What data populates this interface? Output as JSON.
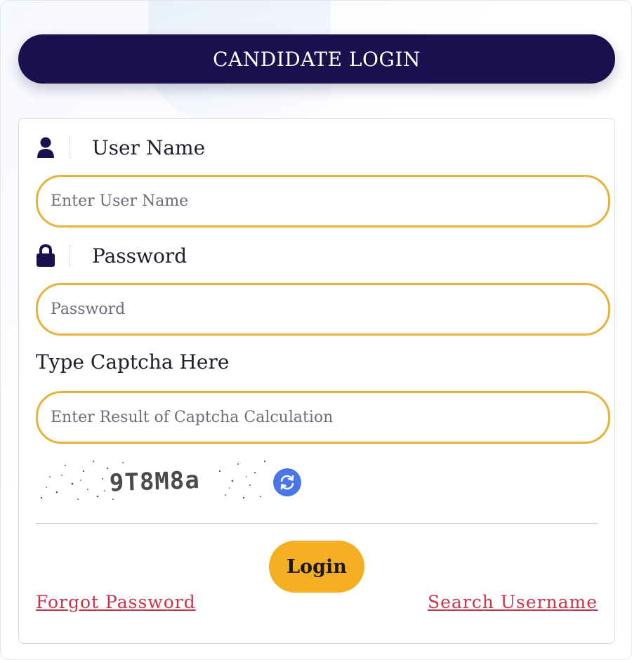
{
  "header": {
    "title": "CANDIDATE LOGIN"
  },
  "form": {
    "username": {
      "label": "User Name",
      "placeholder": "Enter User Name",
      "value": "",
      "icon": "user-icon"
    },
    "password": {
      "label": "Password",
      "placeholder": "Password",
      "value": "",
      "icon": "lock-icon"
    },
    "captcha": {
      "label": "Type Captcha Here",
      "placeholder": "Enter Result of Captcha Calculation",
      "value": "",
      "image_text": "9T8M8a",
      "refresh_icon": "refresh-icon"
    },
    "login_label": "Login",
    "forgot_password_label": "Forgot Password",
    "search_username_label": "Search Username"
  },
  "colors": {
    "header_bg": "#1b0f4d",
    "input_border": "#e5b23c",
    "login_button": "#f4ae22",
    "link": "#c8354a",
    "refresh_button": "#4a76e8"
  }
}
